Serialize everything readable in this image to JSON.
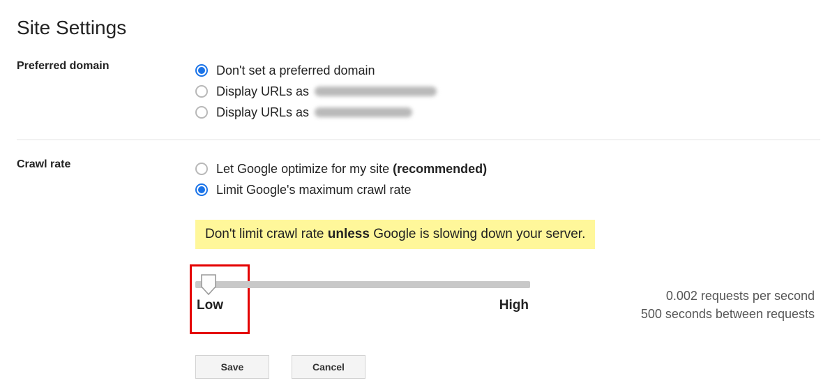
{
  "page_title": "Site Settings",
  "sections": {
    "preferred_domain": {
      "label": "Preferred domain",
      "options": [
        {
          "label": "Don't set a preferred domain",
          "checked": true,
          "redacted": null
        },
        {
          "label": "Display URLs as",
          "checked": false,
          "redacted": "a"
        },
        {
          "label": "Display URLs as",
          "checked": false,
          "redacted": "b"
        }
      ]
    },
    "crawl_rate": {
      "label": "Crawl rate",
      "options": [
        {
          "label": "Let Google optimize for my site",
          "suffix_bold": "(recommended)",
          "checked": false
        },
        {
          "label": "Limit Google's maximum crawl rate",
          "checked": true
        }
      ]
    }
  },
  "warning": {
    "pre": "Don't limit crawl rate ",
    "bold": "unless",
    "post": " Google is slowing down your server."
  },
  "slider": {
    "low_label": "Low",
    "high_label": "High",
    "value_position": 0.02,
    "stat1_num": "0.002",
    "stat1_text": " requests per second",
    "stat2_num": "500",
    "stat2_text": " seconds between requests"
  },
  "buttons": {
    "save": "Save",
    "cancel": "Cancel"
  }
}
